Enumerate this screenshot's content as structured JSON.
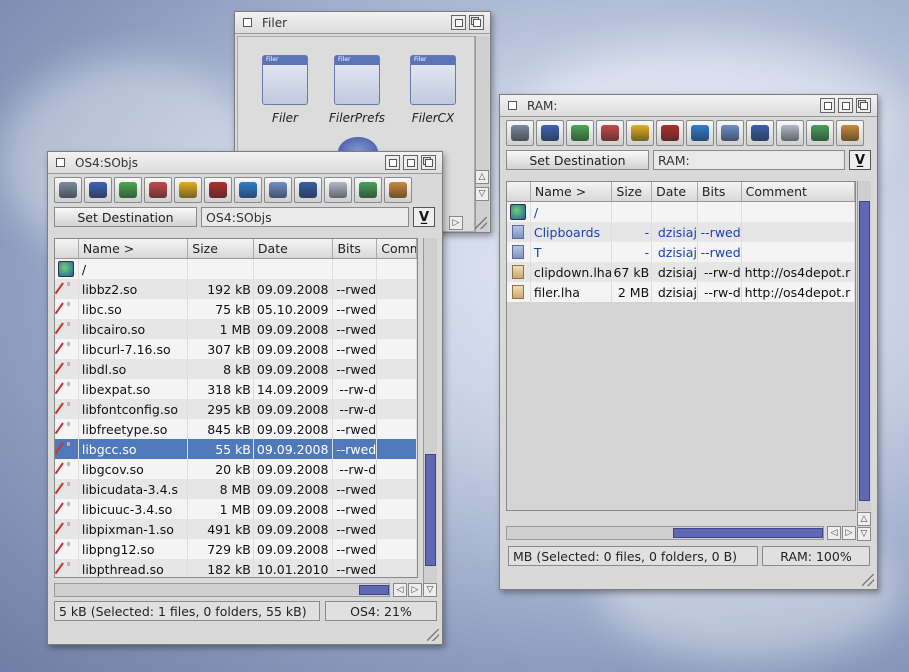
{
  "filer_window": {
    "title": "Filer",
    "icons": [
      {
        "label": "Filer"
      },
      {
        "label": "FilerPrefs"
      },
      {
        "label": "FilerCX"
      }
    ]
  },
  "os4_window": {
    "title": "OS4:SObjs",
    "set_destination_label": "Set Destination",
    "destination_value": "OS4:SObjs",
    "columns": [
      "Name >",
      "Size",
      "Date",
      "Bits",
      "Comm"
    ],
    "rows": [
      {
        "name": "/",
        "size": "",
        "date": "",
        "bits": "",
        "type": "root"
      },
      {
        "name": "libbz2.so",
        "size": "192 kB",
        "date": "09.09.2008",
        "bits": "--rwed",
        "type": "lib"
      },
      {
        "name": "libc.so",
        "size": "75 kB",
        "date": "05.10.2009",
        "bits": "--rwed",
        "type": "lib"
      },
      {
        "name": "libcairo.so",
        "size": "1 MB",
        "date": "09.09.2008",
        "bits": "--rwed",
        "type": "lib"
      },
      {
        "name": "libcurl-7.16.so",
        "size": "307 kB",
        "date": "09.09.2008",
        "bits": "--rwed",
        "type": "lib"
      },
      {
        "name": "libdl.so",
        "size": "8 kB",
        "date": "09.09.2008",
        "bits": "--rwed",
        "type": "lib"
      },
      {
        "name": "libexpat.so",
        "size": "318 kB",
        "date": "14.09.2009",
        "bits": "--rw-d",
        "type": "lib"
      },
      {
        "name": "libfontconfig.so",
        "size": "295 kB",
        "date": "09.09.2008",
        "bits": "--rw-d",
        "type": "lib"
      },
      {
        "name": "libfreetype.so",
        "size": "845 kB",
        "date": "09.09.2008",
        "bits": "--rwed",
        "type": "lib"
      },
      {
        "name": "libgcc.so",
        "size": "55 kB",
        "date": "09.09.2008",
        "bits": "--rwed",
        "type": "lib",
        "selected": true
      },
      {
        "name": "libgcov.so",
        "size": "20 kB",
        "date": "09.09.2008",
        "bits": "--rw-d",
        "type": "lib"
      },
      {
        "name": "libicudata-3.4.s",
        "size": "8 MB",
        "date": "09.09.2008",
        "bits": "--rwed",
        "type": "lib"
      },
      {
        "name": "libicuuc-3.4.so",
        "size": "1 MB",
        "date": "09.09.2008",
        "bits": "--rwed",
        "type": "lib"
      },
      {
        "name": "libpixman-1.so",
        "size": "491 kB",
        "date": "09.09.2008",
        "bits": "--rwed",
        "type": "lib"
      },
      {
        "name": "libpng12.so",
        "size": "729 kB",
        "date": "09.09.2008",
        "bits": "--rwed",
        "type": "lib"
      },
      {
        "name": "libpthread.so",
        "size": "182 kB",
        "date": "10.01.2010",
        "bits": "--rwed",
        "type": "lib"
      }
    ],
    "status_left": "5 kB (Selected: 1 files, 0 folders, 55 kB)",
    "status_right": "OS4: 21%"
  },
  "ram_window": {
    "title": "RAM:",
    "set_destination_label": "Set Destination",
    "destination_value": "RAM:",
    "columns": [
      "Name >",
      "Size",
      "Date",
      "Bits",
      "Comment"
    ],
    "rows": [
      {
        "name": "/",
        "size": "",
        "date": "",
        "bits": "",
        "comment": "",
        "type": "root",
        "dir": true
      },
      {
        "name": "Clipboards",
        "size": "-",
        "date": "dzisiaj",
        "bits": "--rwed",
        "comment": "",
        "type": "dir",
        "dir": true
      },
      {
        "name": "T",
        "size": "-",
        "date": "dzisiaj",
        "bits": "--rwed",
        "comment": "",
        "type": "dir",
        "dir": true
      },
      {
        "name": "clipdown.lha",
        "size": "67 kB",
        "date": "dzisiaj",
        "bits": "--rw-d",
        "comment": "http://os4depot.r",
        "type": "lha"
      },
      {
        "name": "filer.lha",
        "size": "2 MB",
        "date": "dzisiaj",
        "bits": "--rw-d",
        "comment": "http://os4depot.r",
        "type": "lha"
      }
    ],
    "status_left": "MB (Selected: 0 files, 0 folders, 0 B)",
    "status_right": "RAM: 100%"
  },
  "toolbar_icons": [
    "drive-icon",
    "parent-icon",
    "copy-icon",
    "move-icon",
    "rename-icon",
    "delete-icon",
    "makedir-icon",
    "view-icon",
    "info-icon",
    "search-icon",
    "refresh-icon",
    "filter-icon"
  ],
  "toolbar_colors": [
    "#7a8a9e",
    "#3e63b3",
    "#4aa852",
    "#c44a4a",
    "#e0b020",
    "#b03030",
    "#2f7fd0",
    "#6f8fc8",
    "#3a5fa8",
    "#b0b8c8",
    "#47a05a",
    "#c88a3a"
  ]
}
